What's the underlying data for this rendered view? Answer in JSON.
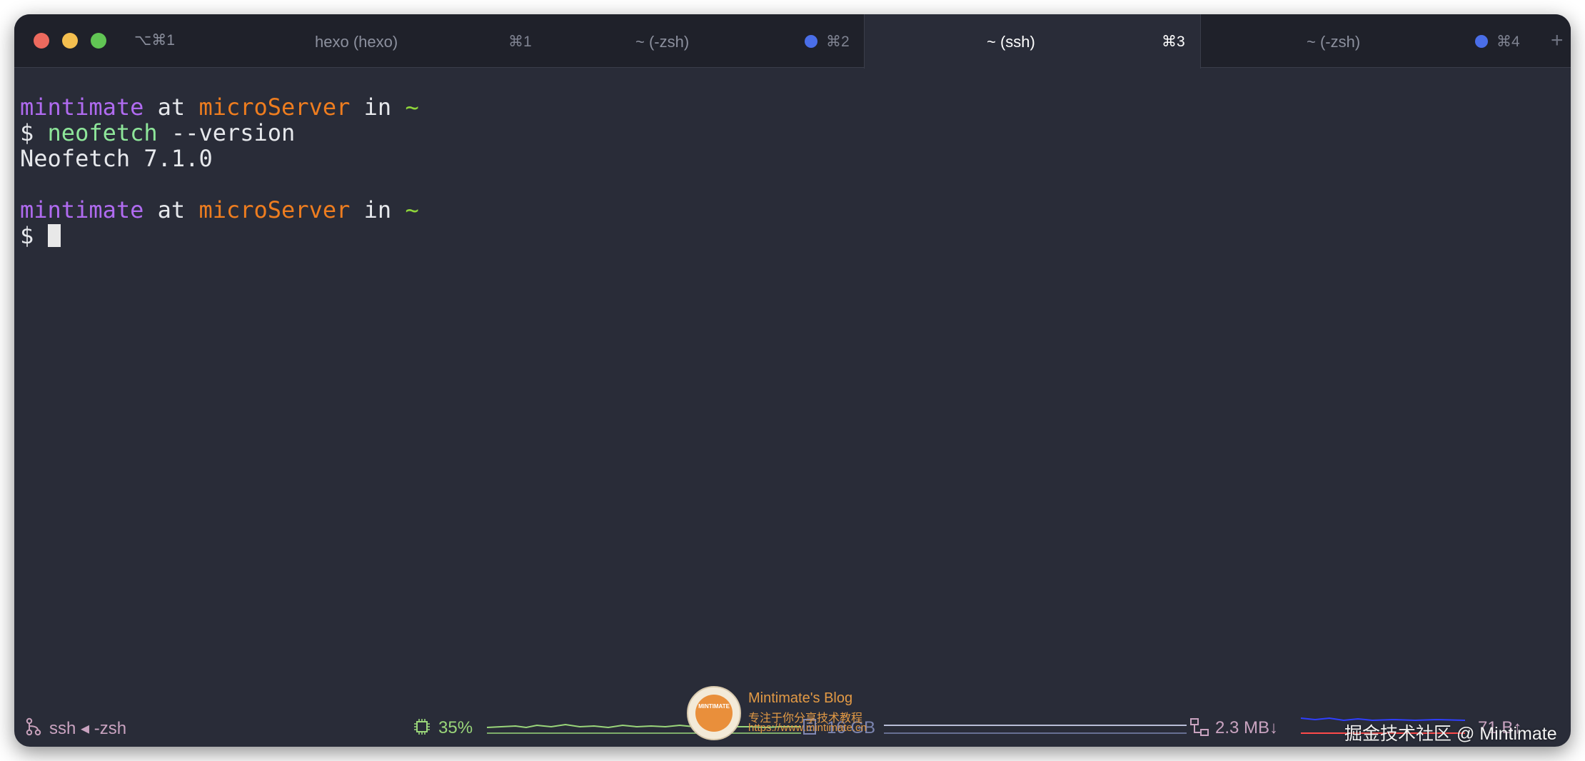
{
  "titlebar": {
    "window_shortcut": "⌥⌘1",
    "tabs": [
      {
        "label": "hexo (hexo)",
        "shortcut": "⌘1",
        "active": false,
        "dot": false
      },
      {
        "label": "~ (-zsh)",
        "shortcut": "⌘2",
        "active": false,
        "dot": true
      },
      {
        "label": "~ (ssh)",
        "shortcut": "⌘3",
        "active": true,
        "dot": false
      },
      {
        "label": "~ (-zsh)",
        "shortcut": "⌘4",
        "active": false,
        "dot": true
      }
    ],
    "new_tab_glyph": "+"
  },
  "terminal": {
    "prompt1": {
      "user": "mintimate",
      "at": " at ",
      "host": "microServer",
      "in": " in ",
      "dir": "~"
    },
    "cmd1": {
      "dollar": "$ ",
      "program": "neofetch",
      "args": " --version"
    },
    "output1": "Neofetch 7.1.0",
    "prompt2": {
      "user": "mintimate",
      "at": " at ",
      "host": "microServer",
      "in": " in ",
      "dir": "~"
    },
    "cmd2": {
      "dollar": "$ "
    }
  },
  "statusbar": {
    "job": "ssh ◂ -zsh",
    "cpu": "35%",
    "memory": "16 GB",
    "network": "2.3 MB↓",
    "network_extra": "71 B↑",
    "icons": [
      "branch-icon",
      "cpu-icon",
      "memory-icon",
      "network-icon"
    ],
    "colors": {
      "cpu": "#9ad67a",
      "memory": "#7c85b0",
      "network": "#c9a3c0",
      "upload": "#2f3fff",
      "download": "#ff4a4a"
    }
  },
  "watermark": {
    "logo_text": "MINTIMATE",
    "title": "Mintimate's Blog",
    "subtitle": "专注于你分享技术教程",
    "url": "https://www.mintimate.cn"
  },
  "credit": "掘金技术社区 @ Mintimate"
}
